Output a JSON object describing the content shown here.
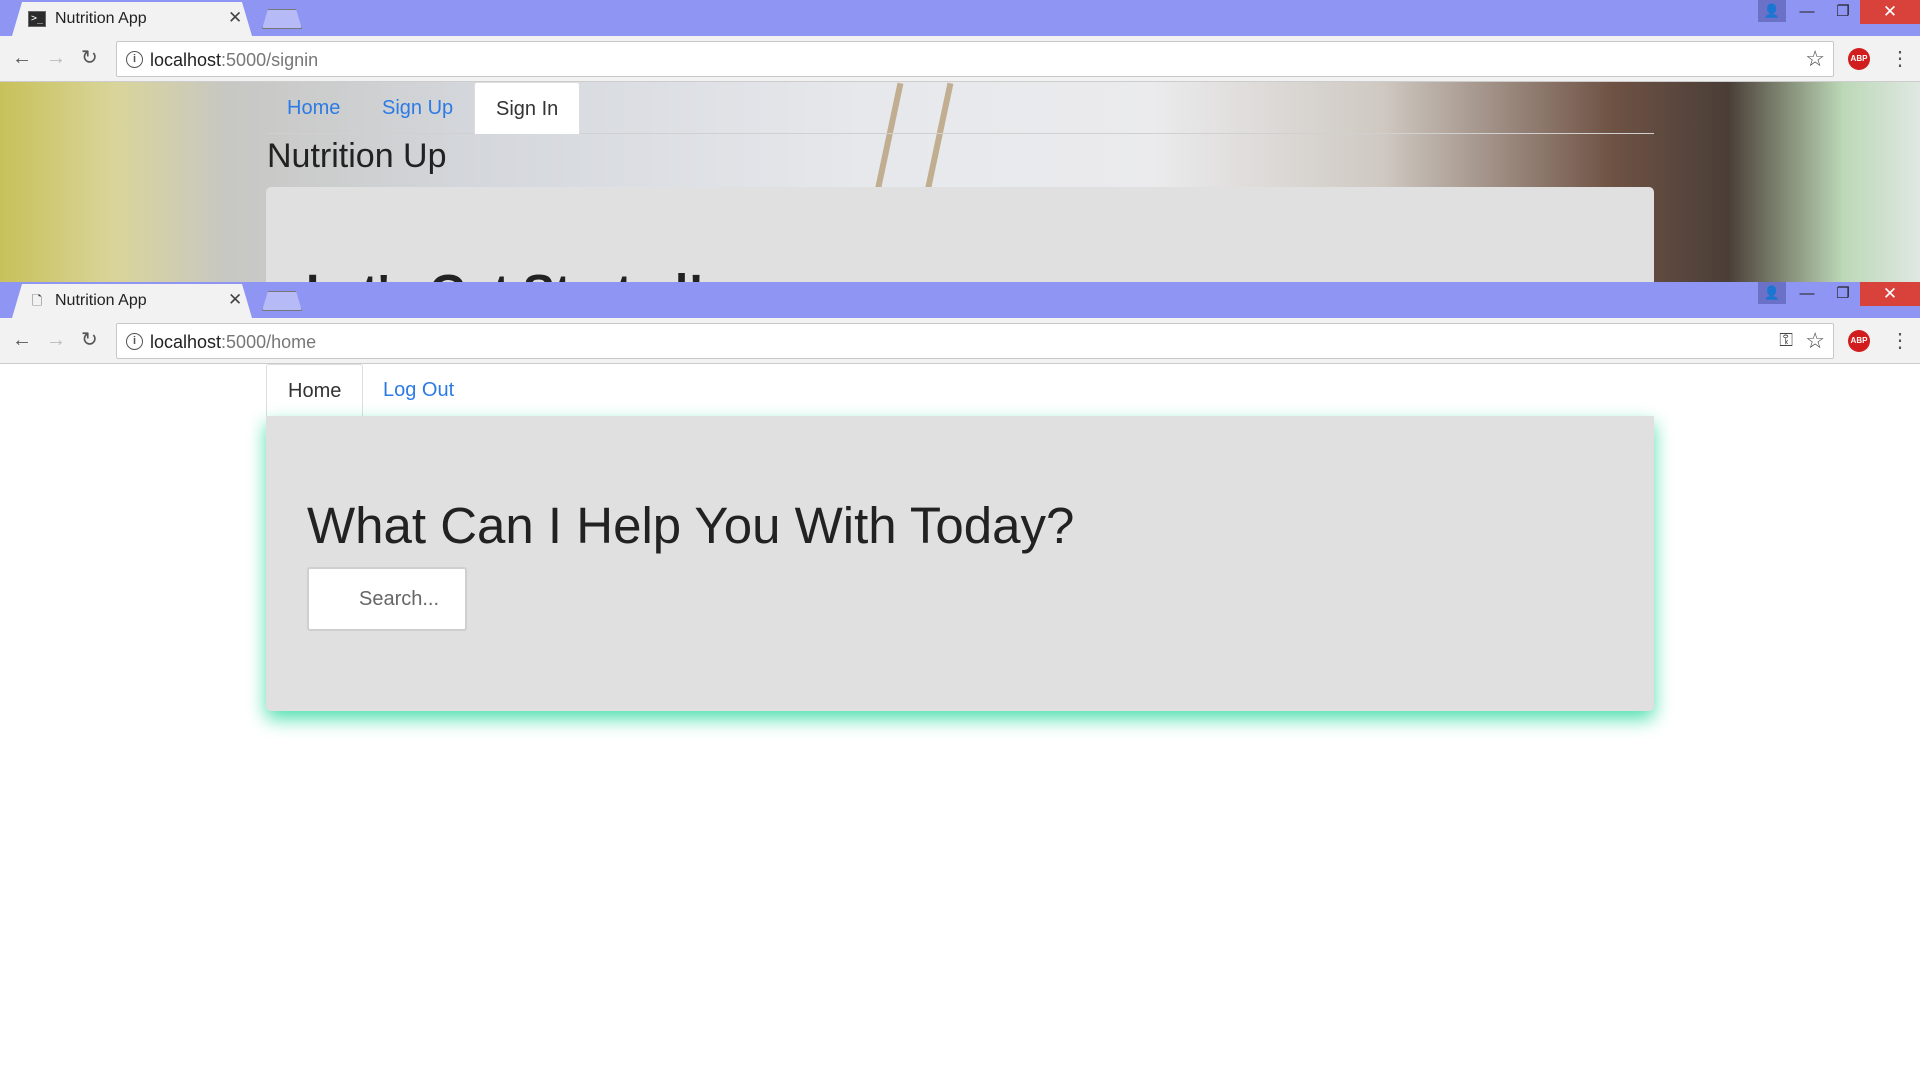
{
  "window1": {
    "tab_title": "Nutrition App",
    "url_host": "localhost",
    "url_rest": ":5000/signin",
    "nav_tabs": [
      "Home",
      "Sign Up",
      "Sign In"
    ],
    "brand": "Nutrition Up",
    "card_heading": "Let's Get Started!"
  },
  "window2": {
    "tab_title": "Nutrition App",
    "url_host": "localhost",
    "url_rest": ":5000/home",
    "nav_tabs": [
      "Home",
      "Log Out"
    ],
    "card_heading": "What Can I Help You With Today?",
    "search_placeholder": "Search..."
  },
  "browser": {
    "abp_label": "ABP",
    "titlebar_color": "#8f95f3",
    "close_color": "#d9413b"
  },
  "theme": {
    "link_color": "#2c7be5",
    "card_bg": "#e0e0e0",
    "card_glow": "#16d696"
  }
}
